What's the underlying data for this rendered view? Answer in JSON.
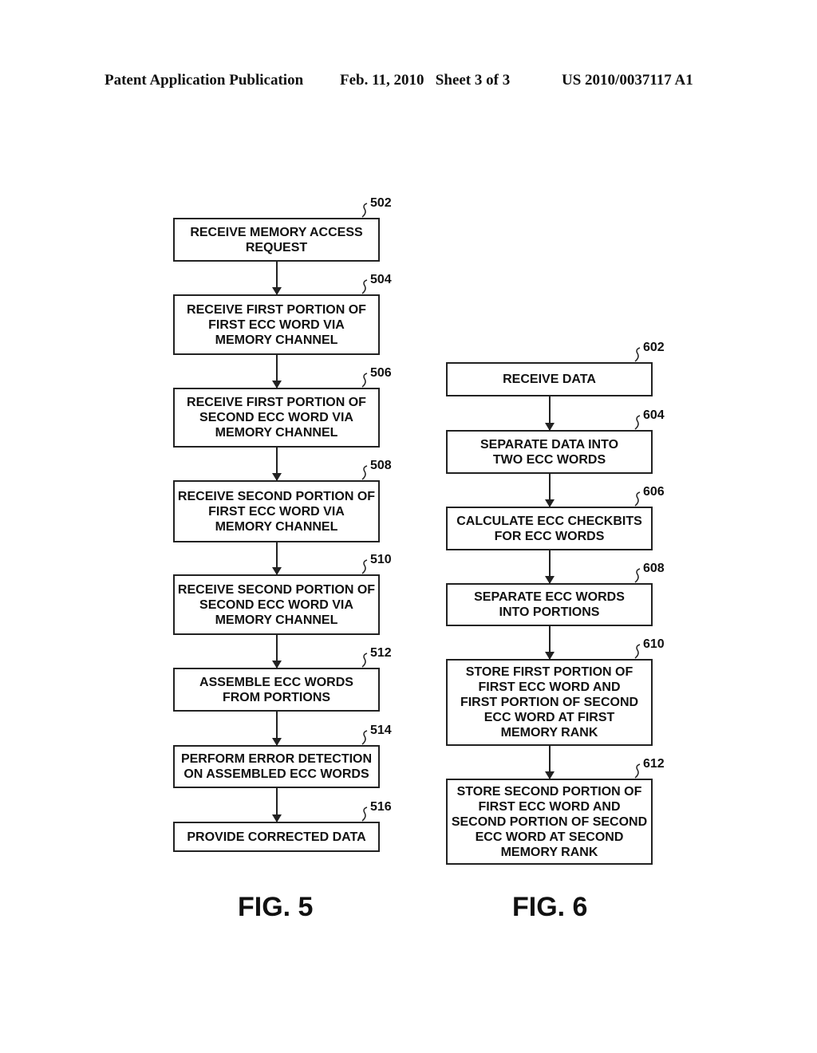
{
  "header": {
    "publication": "Patent Application Publication",
    "date_sheet": "Feb. 11, 2010   Sheet 3 of 3",
    "number": "US 2010/0037117 A1"
  },
  "fig5": {
    "label": "FIG. 5",
    "steps": [
      {
        "ref": "502",
        "text": "RECEIVE MEMORY ACCESS\nREQUEST"
      },
      {
        "ref": "504",
        "text": "RECEIVE FIRST PORTION OF\nFIRST ECC WORD VIA\nMEMORY CHANNEL"
      },
      {
        "ref": "506",
        "text": "RECEIVE FIRST PORTION OF\nSECOND ECC WORD VIA\nMEMORY CHANNEL"
      },
      {
        "ref": "508",
        "text": "RECEIVE SECOND PORTION OF\nFIRST ECC WORD VIA\nMEMORY CHANNEL"
      },
      {
        "ref": "510",
        "text": "RECEIVE SECOND PORTION OF\nSECOND ECC WORD VIA\nMEMORY CHANNEL"
      },
      {
        "ref": "512",
        "text": "ASSEMBLE ECC WORDS\nFROM PORTIONS"
      },
      {
        "ref": "514",
        "text": "PERFORM ERROR DETECTION\nON ASSEMBLED ECC WORDS"
      },
      {
        "ref": "516",
        "text": "PROVIDE CORRECTED DATA"
      }
    ]
  },
  "fig6": {
    "label": "FIG. 6",
    "steps": [
      {
        "ref": "602",
        "text": "RECEIVE DATA"
      },
      {
        "ref": "604",
        "text": "SEPARATE DATA INTO\nTWO ECC WORDS"
      },
      {
        "ref": "606",
        "text": "CALCULATE ECC CHECKBITS\nFOR ECC WORDS"
      },
      {
        "ref": "608",
        "text": "SEPARATE ECC WORDS\nINTO PORTIONS"
      },
      {
        "ref": "610",
        "text": "STORE FIRST PORTION OF\nFIRST ECC WORD AND\nFIRST PORTION OF SECOND\nECC WORD AT FIRST\nMEMORY RANK"
      },
      {
        "ref": "612",
        "text": "STORE SECOND PORTION OF\nFIRST ECC WORD AND\nSECOND PORTION OF SECOND\nECC WORD AT SECOND\nMEMORY RANK"
      }
    ]
  }
}
